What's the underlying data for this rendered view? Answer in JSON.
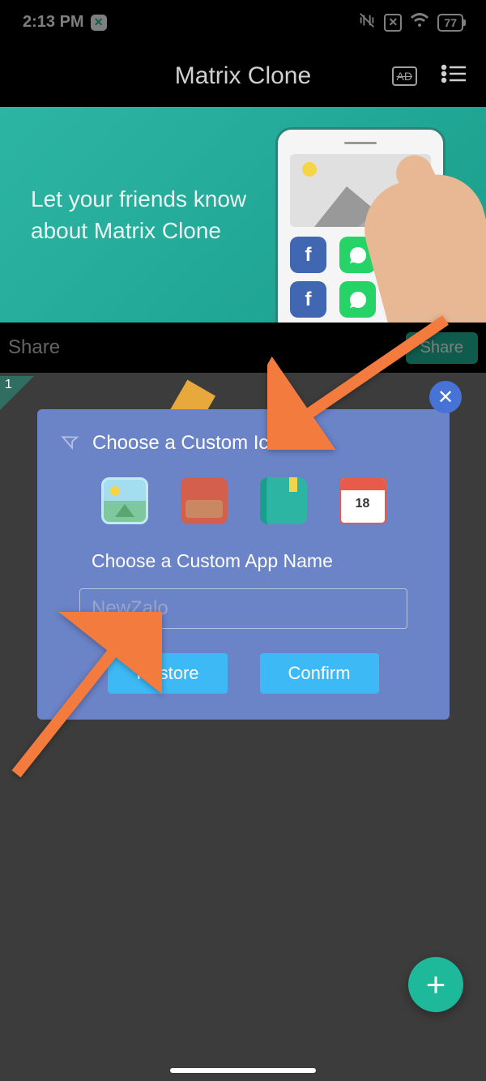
{
  "statusbar": {
    "time": "2:13 PM",
    "battery": "77"
  },
  "header": {
    "title": "Matrix Clone",
    "ad_label": "AD"
  },
  "banner": {
    "line1": "Let your friends know",
    "line2": "about Matrix Clone"
  },
  "sharebar": {
    "label": "Share",
    "button": "Share"
  },
  "app_badge": "1",
  "modal": {
    "title": "Choose a Custom Icon",
    "name_label": "Choose a Custom App Name",
    "name_value": "NewZalo",
    "restore": "Restore",
    "confirm": "Confirm",
    "calendar_num": "18",
    "icons": [
      "gallery",
      "wallet",
      "notebook",
      "calendar"
    ]
  },
  "fab": "+",
  "close": "✕"
}
